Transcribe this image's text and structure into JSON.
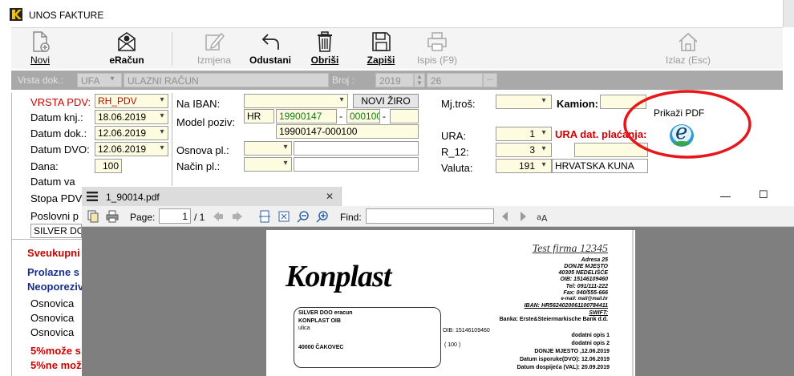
{
  "window": {
    "title": "UNOS FAKTURE"
  },
  "toolbar": {
    "novi": "Novi",
    "eracun": "eRačun",
    "izmjena": "Izmjena",
    "odustani": "Odustani",
    "obrisi": "Obriši",
    "zapisi": "Zapiši",
    "ispis": "Ispis (F9)",
    "izlaz": "Izlaz (Esc)"
  },
  "docbar": {
    "vrsta_label": "Vrsta dok.:",
    "vrsta_code": "UFA",
    "vrsta_name": "ULAZNI RAČUN",
    "broj_label": "Broj :",
    "broj_year": "2019",
    "broj_num": "26",
    "ellipsis": "..."
  },
  "form": {
    "vrsta_pdv_label": "VRSTA PDV:",
    "vrsta_pdv_value": "RH_PDV",
    "datum_knj_label": "Datum knj.:",
    "datum_knj_value": "18.06.2019",
    "datum_dok_label": "Datum dok.:",
    "datum_dok_value": "12.06.2019",
    "datum_dvo_label": "Datum DVO:",
    "datum_dvo_value": "12.06.2019",
    "dana_label": "Dana:",
    "dana_value": "100",
    "datum_val_label": "Datum va",
    "stopa_label": "Stopa PDV",
    "poslovni_label": "Poslovni p",
    "partner_value": "SILVER DO",
    "na_iban_label": "Na IBAN:",
    "novi_ziro_button": "NOVI ŽIRO",
    "model_label": "Model poziv:",
    "model_value": "HR",
    "poziv_1": "19900147",
    "poziv_dash": "-",
    "poziv_2": "000100",
    "poziv_full": "19900147-000100",
    "osnova_label": "Osnova pl.:",
    "nacin_label": "Način pl.:",
    "mjtros_label": "Mj.troš:",
    "kamion_label": "Kamion:",
    "ura_label": "URA:",
    "ura_value": "1",
    "ura_dat_label": "URA dat. plaćanja:",
    "r12_label": "R_12:",
    "r12_value": "3",
    "valuta_label": "Valuta:",
    "valuta_value": "191",
    "valuta_name": "HRVATSKA KUNA",
    "prikazi_pdf": "Prikaži PDF",
    "pdf_icon_letter": "e",
    "sveukupni": "Sveukupni",
    "prolazne": "Prolazne s",
    "neoporezivo": "Neoporeziv",
    "osnovica1": "Osnovica",
    "osnovica2": "Osnovica",
    "osnovica3": "Osnovica",
    "moze": "5%može s",
    "nemoze": "5%ne mož"
  },
  "viewer": {
    "tab_title": "1_90014.pdf",
    "close": "✕",
    "minimize": "—",
    "maximize": "☐",
    "page_label": "Page:",
    "page_value": "1",
    "page_total": "/ 1",
    "find_label": "Find:"
  },
  "pdf": {
    "firm": "Test firma 12345",
    "addr": [
      "Adresa 25",
      "DONJE MJESTO",
      "40305 NEDELIŠĆE",
      "OIB: 15146109460",
      "Tel: 091/111-222",
      "Fax: 040/555-666",
      "e-mail: mail@mail.hr",
      "IBAN: HR5624020061100784411",
      "SWIFT:",
      "Banka: Erste&Steiermarkische Bank d.d."
    ],
    "logo": "Konplast",
    "box": [
      "SILVER DOO eracun",
      "KONPLAST OIB",
      "ulica"
    ],
    "box_city": "40000    ČAKOVEC",
    "client_oib": "OIB: 15146109460",
    "client_code": "(    100    )",
    "info": [
      "dodatni opis 1",
      "dodatni opis 2",
      "DONJE MJESTO ,12.06.2019",
      "Datum isporuke(DVO): 12.06.2019",
      "Datum dospijeća (VAL): 20.09.2019"
    ]
  }
}
